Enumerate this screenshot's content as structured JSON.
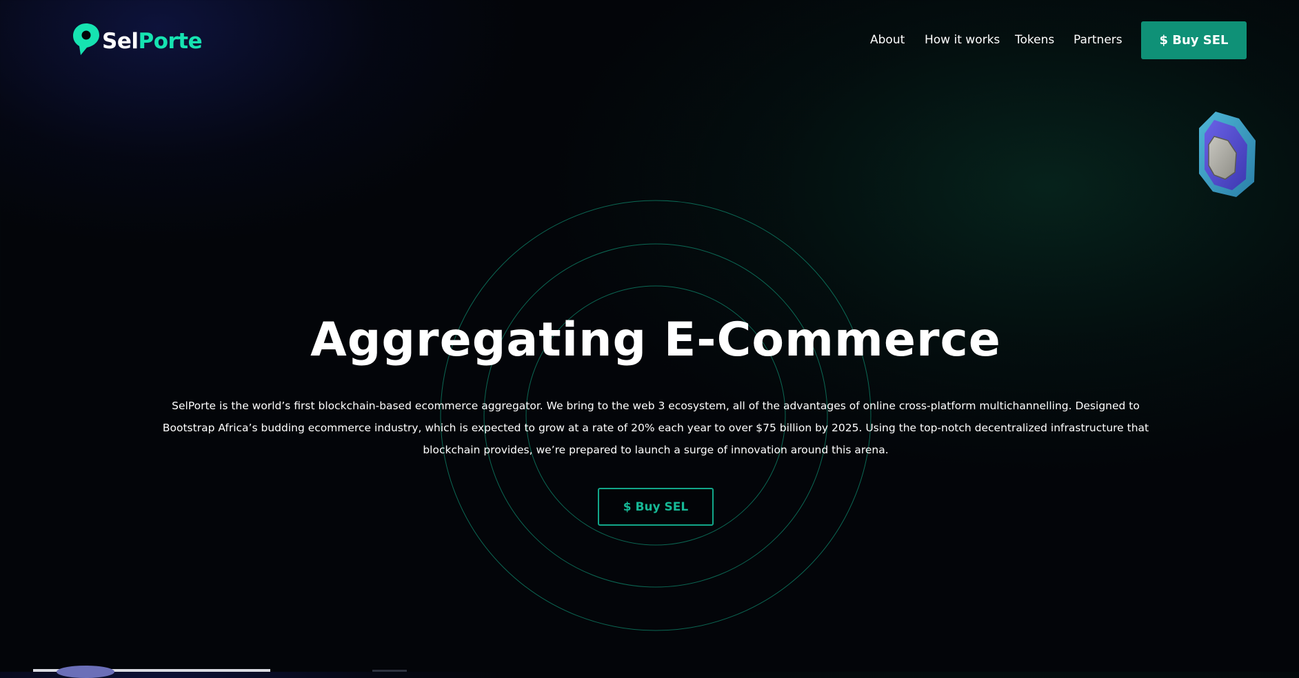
{
  "brand": {
    "name_part1": "Sel",
    "name_part2": "Porte",
    "colors": {
      "accent": "#16e3b1",
      "button": "#0f9177",
      "ring": "#0f8a6e"
    }
  },
  "nav": {
    "links": [
      "About",
      "How it works",
      "Tokens",
      "Partners"
    ],
    "cta_label": "$ Buy SEL"
  },
  "hero": {
    "title": "Aggregating E-Commerce",
    "description": "SelPorte is the world’s first blockchain-based ecommerce aggregator. We bring to the web 3 ecosystem, all of the advantages of online cross-platform multichannelling. Designed to Bootstrap Africa’s budding ecommerce industry, which is expected to grow at a rate of 20% each year to over $75 billion by 2025. Using the top-notch decentralized infrastructure that blockchain provides, we’re prepared to launch a surge of innovation around this arena.",
    "cta_label": "$ Buy SEL"
  },
  "icons": {
    "logo": "location-pin-logo-icon",
    "decoration": "shield-icon"
  }
}
